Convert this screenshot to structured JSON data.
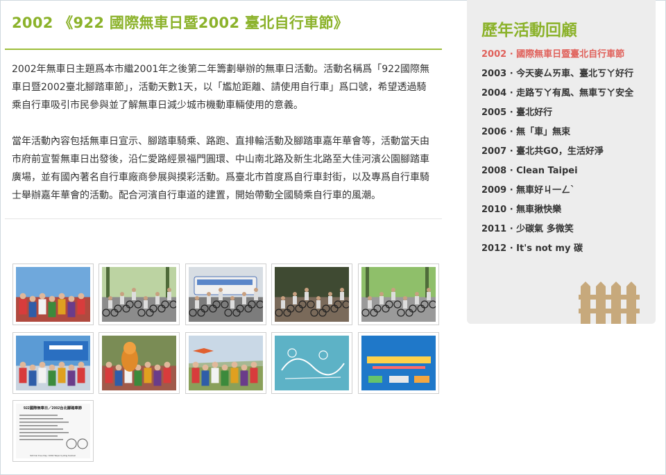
{
  "article": {
    "title": "2002 《922 國際無車日暨2002 臺北自行車節》",
    "paragraph1": "2002年無車日主題爲本市繼2001年之後第二年籌劃舉辦的無車日活動。活動名稱爲「922國際無車日暨2002臺北腳踏車節」，活動天數1天，以「尷尬距離、請使用自行車」爲口號，希望透過騎乘自行車吸引市民參與並了解無車日減少城市機動車輛使用的意義。",
    "paragraph2": "當年活動內容包括無車日宣示、腳踏車騎乘、路跑、直排輪活動及腳踏車嘉年華會等，活動當天由市府前宣誓無車日出發後，沿仁愛路經景福門圓環、中山南北路及新生北路至大佳河濱公園腳踏車廣場，並有國內著名自行車廠商參展與摸彩活動。爲臺北市首度爲自行車封街，以及專爲自行車騎士舉辦嘉年華會的活動。配合河濱自行車道的建置，開始帶動全國騎乘自行車的風潮。"
  },
  "gallery": {
    "poster_text": {
      "title": "922國際無車日／2002台北腳踏車節",
      "footer": "922 Car Free Day / 2002 Taipei Cycling Festival"
    },
    "photos": [
      {
        "kind": "people",
        "sky": "#6fa8dc",
        "ground": "#b04a3f"
      },
      {
        "kind": "street",
        "sky": "#bcd3a2",
        "ground": "#8c8c8c"
      },
      {
        "kind": "bus",
        "sky": "#d7dde3",
        "ground": "#7c7c7c"
      },
      {
        "kind": "crowd",
        "sky": "#3f4a32",
        "ground": "#7a6a5a"
      },
      {
        "kind": "road",
        "sky": "#8fbf6a",
        "ground": "#9a9a9a"
      },
      {
        "kind": "stage",
        "sky": "#5b9bd5",
        "ground": "#c9d4e0"
      },
      {
        "kind": "mascot",
        "sky": "#7a8c55",
        "ground": "#a05a4a"
      },
      {
        "kind": "field",
        "sky": "#c9d8e6",
        "ground": "#8aa05a"
      },
      {
        "kind": "art",
        "sky": "#5fb3c7",
        "ground": "#4a9fb5"
      },
      {
        "kind": "banner",
        "sky": "#1e73c8",
        "ground": "#2a8fd8"
      },
      {
        "kind": "poster",
        "sky": "#f5f5f5",
        "ground": "#e8e8e8"
      }
    ]
  },
  "sidebar": {
    "title": "歷年活動回顧",
    "items": [
      {
        "label": "2002 · 國際無車日暨臺北自行車節",
        "active": true
      },
      {
        "label": "2003 · 今天麥ㄙㄞ車、臺北ㄎㄚ好行",
        "active": false
      },
      {
        "label": "2004 · 走路ㄎㄚ有風、無車ㄎㄚ安全",
        "active": false
      },
      {
        "label": "2005 · 臺北好行",
        "active": false
      },
      {
        "label": "2006 · 無「車」無束",
        "active": false
      },
      {
        "label": "2007 · 臺北共GO，生活好淨",
        "active": false
      },
      {
        "label": "2008 · Clean Taipei",
        "active": false
      },
      {
        "label": "2009 · 無車好ㄐ一ㄥˋ",
        "active": false
      },
      {
        "label": "2010 · 無車揪快樂",
        "active": false
      },
      {
        "label": "2011 · 少碳氣 多微笑",
        "active": false
      },
      {
        "label": "2012 · It's not my 碳",
        "active": false
      }
    ]
  },
  "colors": {
    "accent_green": "#8bb22a",
    "active_red": "#e0605a",
    "sidebar_bg": "#ededed",
    "fence_tan": "#c7a97c"
  }
}
